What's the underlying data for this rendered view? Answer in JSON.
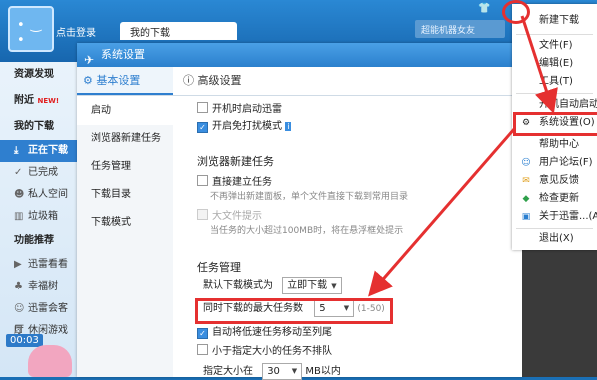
{
  "app": {
    "login_text": "点击登录",
    "tab_label": "我的下载",
    "robot_label": "超能机器女友",
    "timer": "00:03"
  },
  "sidebar": {
    "discover": "资源发现",
    "recent": "附近",
    "recent_badge": "NEW!",
    "my_downloads": "我的下载",
    "items": [
      "正在下载",
      "已完成",
      "私人空间",
      "垃圾箱"
    ],
    "features": "功能推荐",
    "feature_items": [
      "迅雷看看",
      "幸福树",
      "迅雷会客厅",
      "休闲游戏"
    ]
  },
  "dialog": {
    "title": "系统设置",
    "tab_basic": "基本设置",
    "tab_advanced": "高级设置",
    "nav": [
      "启动",
      "浏览器新建任务",
      "任务管理",
      "下载目录",
      "下载模式"
    ],
    "startup": {
      "auto_start": "开机时启动迅雷",
      "no_disturb": "开启免打扰模式"
    },
    "browser": {
      "heading": "浏览器新建任务",
      "direct_create": "直接建立任务",
      "direct_hint": "不再弹出新建面板，单个文件直接下载到常用目录",
      "big_file": "大文件提示",
      "big_file_hint": "当任务的大小超过100MB时，将在悬浮框处提示"
    },
    "tasks": {
      "heading": "任务管理",
      "default_mode_label": "默认下载模式为",
      "default_mode_value": "立即下载",
      "max_tasks_label": "同时下载的最大任务数",
      "max_tasks_value": "5",
      "max_tasks_range": "(1-50)",
      "auto_move": "自动将低速任务移动至列尾",
      "no_queue": "小于指定大小的任务不排队",
      "size_label": "指定大小在",
      "size_value": "30",
      "size_unit": "MB以内"
    }
  },
  "menu": {
    "items": [
      "新建下载",
      "文件(F)",
      "编辑(E)",
      "工具(T)",
      "开机自动启动(",
      "系统设置(O)",
      "帮助中心",
      "用户论坛(F)",
      "意见反馈",
      "检查更新",
      "关于迅雷...(A)",
      "退出(X)"
    ]
  },
  "colors": {
    "accent": "#2f7fcf",
    "highlight": "#e53030"
  }
}
